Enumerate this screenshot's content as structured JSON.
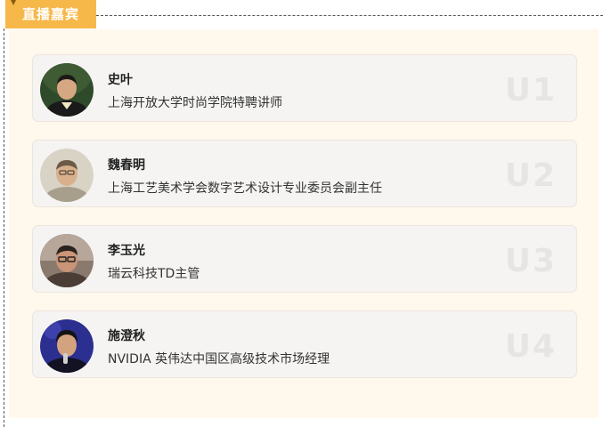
{
  "section": {
    "title": "直播嘉宾"
  },
  "guests": [
    {
      "name": "史叶",
      "role": "上海开放大学时尚学院特聘讲师",
      "mark": "U1",
      "avatar_icon": "person-portrait-icon"
    },
    {
      "name": "魏春明",
      "role": "上海工艺美术学会数字艺术设计专业委员会副主任",
      "mark": "U2",
      "avatar_icon": "person-portrait-icon"
    },
    {
      "name": "李玉光",
      "role": "瑞云科技TD主管",
      "mark": "U3",
      "avatar_icon": "person-portrait-icon"
    },
    {
      "name": "施澄秋",
      "role": "NVIDIA 英伟达中国区高级技术市场经理",
      "mark": "U4",
      "avatar_icon": "person-portrait-icon"
    }
  ],
  "colors": {
    "accent": "#f7b84a",
    "panel_bg": "#fff8ec",
    "card_bg": "#f5f4f2",
    "mark": "#e6e5e3"
  }
}
